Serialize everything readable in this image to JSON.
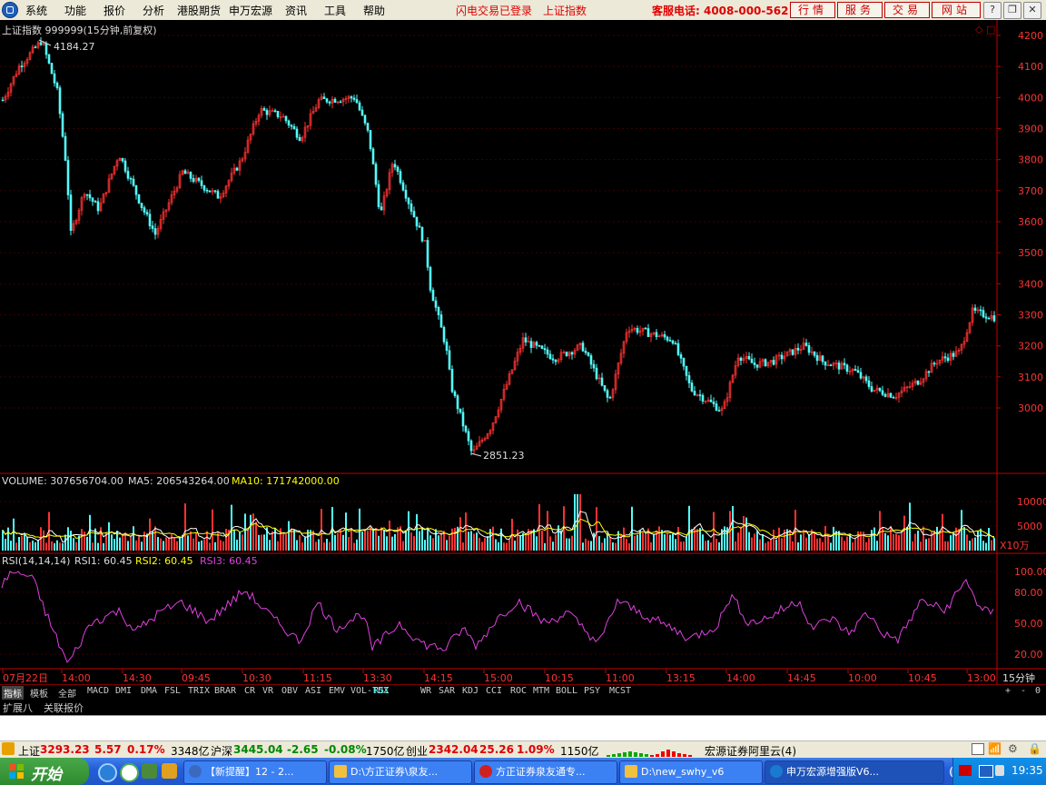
{
  "menubar": {
    "items": [
      "系统",
      "功能",
      "报价",
      "分析",
      "港股期货",
      "申万宏源",
      "资讯",
      "工具",
      "帮助"
    ],
    "status_login": "闪电交易已登录",
    "status_index": "上证指数",
    "service_phone": "客服电话: 4008-000-562",
    "tabs": [
      "行情",
      "服务",
      "交易",
      "网站"
    ]
  },
  "chart": {
    "title": "上证指数 999999(15分钟,前复权)",
    "high_label": "4184.27",
    "low_label": "2851.23",
    "price_axis": [
      "4200",
      "4100",
      "4000",
      "3900",
      "3800",
      "3700",
      "3600",
      "3500",
      "3400",
      "3300",
      "3200",
      "3100",
      "3000"
    ],
    "volume": {
      "label": "VOLUME: 307656704.00",
      "ma5": "MA5: 206543264.00",
      "ma10": "MA10: 171742000.00",
      "axis": [
        "10000",
        "5000"
      ],
      "unit": "X10万"
    },
    "rsi": {
      "label": "RSI(14,14,14)",
      "rsi1": "RSI1: 60.45",
      "rsi2": "RSI2: 60.45",
      "rsi3": "RSI3: 60.45",
      "axis": [
        "100.00",
        "80.00",
        "50.00",
        "20.00"
      ]
    },
    "time_labels": [
      "07月22日",
      "14:00",
      "14:30",
      "09:45",
      "10:30",
      "11:15",
      "13:30",
      "14:15",
      "15:00",
      "10:15",
      "11:00",
      "13:15",
      "14:00",
      "14:45",
      "10:00",
      "10:45",
      "13:00"
    ],
    "period": "15分钟"
  },
  "indicator_tabs": [
    "指标",
    "模板",
    "全部",
    "MACD",
    "DMI",
    "DMA",
    "FSL",
    "TRIX",
    "BRAR",
    "CR",
    "VR",
    "OBV",
    "ASI",
    "EMV",
    "VOL-TDX",
    "RSI",
    "WR",
    "SAR",
    "KDJ",
    "CCI",
    "ROC",
    "MTM",
    "BOLL",
    "PSY",
    "MCST"
  ],
  "indicator_active": "RSI",
  "right_controls": [
    "+",
    "-",
    "0"
  ],
  "sub_tabs": [
    "扩展八",
    "关联报价"
  ],
  "statusbar": {
    "sh_label": "上证",
    "sh_value": "3293.23",
    "sh_change": "5.57",
    "sh_pct": "0.17%",
    "sh_amount": "3348亿",
    "sz_label": "沪深",
    "sz_value": "3445.04",
    "sz_change": "-2.65",
    "sz_pct": "-0.08%",
    "sz_amount": "1750亿",
    "cy_label": "创业",
    "cy_value": "2342.04",
    "cy_change": "25.26",
    "cy_pct": "1.09%",
    "cy_amount": "1150亿",
    "server": "宏源证券阿里云(4)"
  },
  "taskbar": {
    "start": "开始",
    "tasks": [
      "【新提醒】12 - 2...",
      "D:\\方正证券\\泉友...",
      "方正证券泉友通专...",
      "D:\\new_swhy_v6",
      "申万宏源增强版V6..."
    ],
    "clock": "19:35"
  },
  "colors": {
    "up": "#ff3232",
    "down": "#54fcfc",
    "rsi": "#e040e0",
    "ma5": "#ffffff",
    "ma10": "#ffff00",
    "axis": "#c00000"
  }
}
